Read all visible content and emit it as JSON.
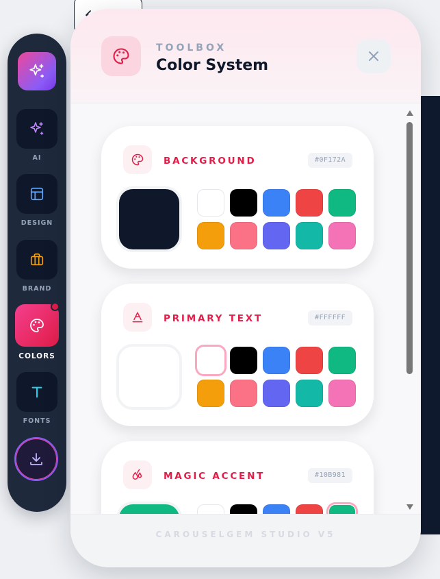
{
  "rail": {
    "logo_icon": "sparkles-icon",
    "items": [
      {
        "label": "AI",
        "icon": "sparkles-icon"
      },
      {
        "label": "DESIGN",
        "icon": "layout-icon"
      },
      {
        "label": "BRAND",
        "icon": "briefcase-icon"
      },
      {
        "label": "COLORS",
        "icon": "palette-icon",
        "active": true
      },
      {
        "label": "FONTS",
        "icon": "type-icon"
      }
    ],
    "download_icon": "download-icon"
  },
  "header": {
    "kicker": "TOOLBOX",
    "title": "Color System",
    "icon": "palette-icon",
    "close_icon": "close-icon"
  },
  "palette": [
    "#FFFFFF",
    "#000000",
    "#3B82F6",
    "#EF4444",
    "#10B981",
    "#F59E0B",
    "#FB7185",
    "#6366F1",
    "#14B8A6",
    "#F472B6"
  ],
  "cards": [
    {
      "title": "BACKGROUND",
      "hex": "#0F172A",
      "icon": "palette-icon"
    },
    {
      "title": "PRIMARY TEXT",
      "hex": "#FFFFFF",
      "icon": "text-color-icon"
    },
    {
      "title": "MAGIC ACCENT",
      "hex": "#10B981",
      "icon": "droplets-icon"
    }
  ],
  "footer": {
    "text": "CAROUSELGEM STUDIO V5"
  }
}
